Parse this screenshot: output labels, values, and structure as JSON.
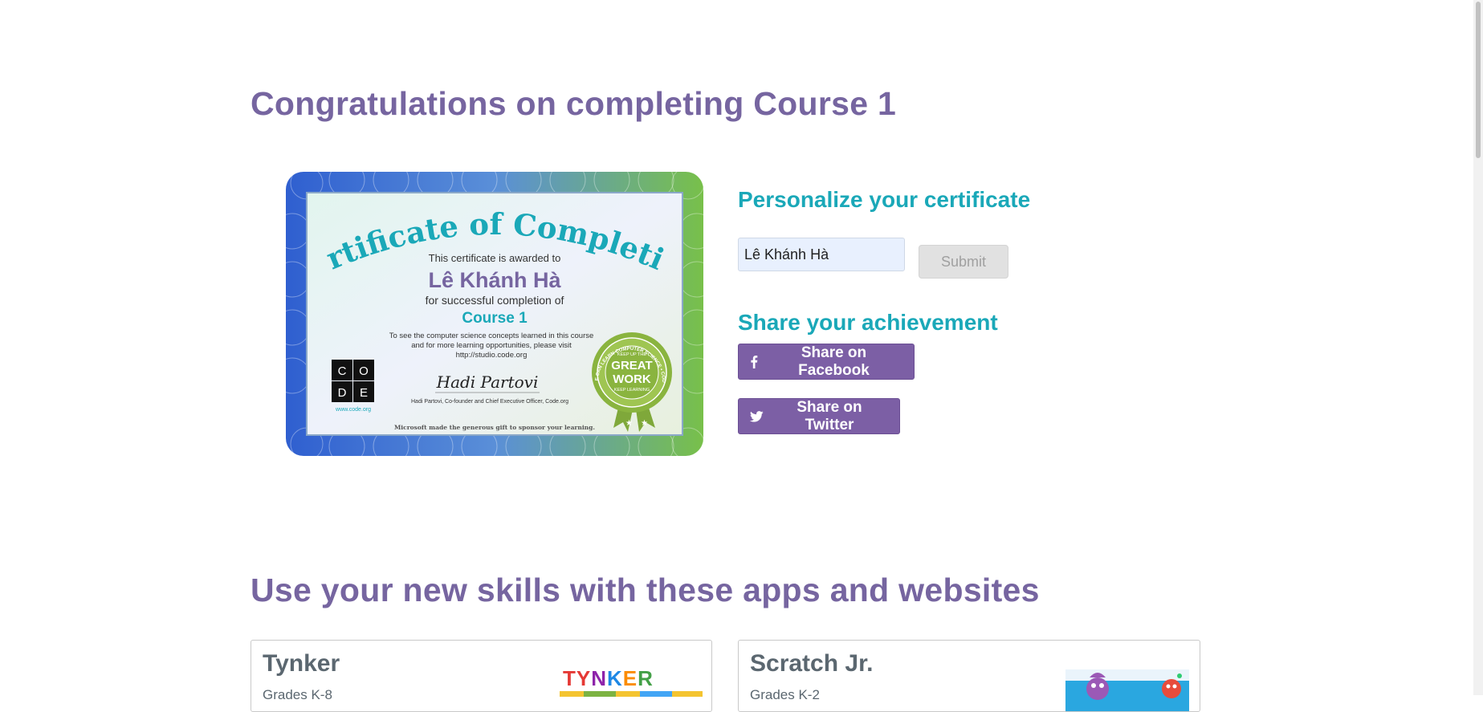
{
  "page": {
    "title": "Congratulations on completing Course 1"
  },
  "certificate": {
    "heading": "Certificate of Completion",
    "awarded_line": "This certificate is awarded to",
    "recipient": "Lê Khánh Hà",
    "completion_line": "for successful completion of",
    "course": "Course 1",
    "info_line1": "To see the computer science concepts learned in this course",
    "info_line2": "and for more learning opportunities, please visit",
    "info_line3": "http://studio.code.org",
    "logo_letters": [
      "C",
      "O",
      "D",
      "E"
    ],
    "logo_url": "www.code.org",
    "signature": "Hadi Partovi",
    "signer_title": "Hadi Partovi, Co-founder and Chief Executive Officer, Code.org",
    "sponsor_line": "Microsoft made the generous gift to sponsor your learning.",
    "badge_top": "KEEP UP THE",
    "badge_main1": "GREAT",
    "badge_main2": "WORK",
    "badge_bottom": "KEEP LEARNING",
    "badge_ring": "ANYONE CAN LEARN COMPUTER SCIENCE • CODE.ORG"
  },
  "personalize": {
    "title": "Personalize your certificate",
    "name_value": "Lê Khánh Hà",
    "submit_label": "Submit"
  },
  "share": {
    "title": "Share your achievement",
    "facebook_label": "Share on Facebook",
    "twitter_label": "Share on Twitter"
  },
  "apps": {
    "title": "Use your new skills with these apps and websites",
    "cards": [
      {
        "name": "Tynker",
        "subtitle": "Grades K-8",
        "logo_text": "TYNKER"
      },
      {
        "name": "Scratch Jr.",
        "subtitle": "Grades K-2"
      }
    ]
  },
  "colors": {
    "purple_heading": "#7665a0",
    "teal_heading": "#1aa8b8",
    "share_button": "#7c5fa5"
  }
}
